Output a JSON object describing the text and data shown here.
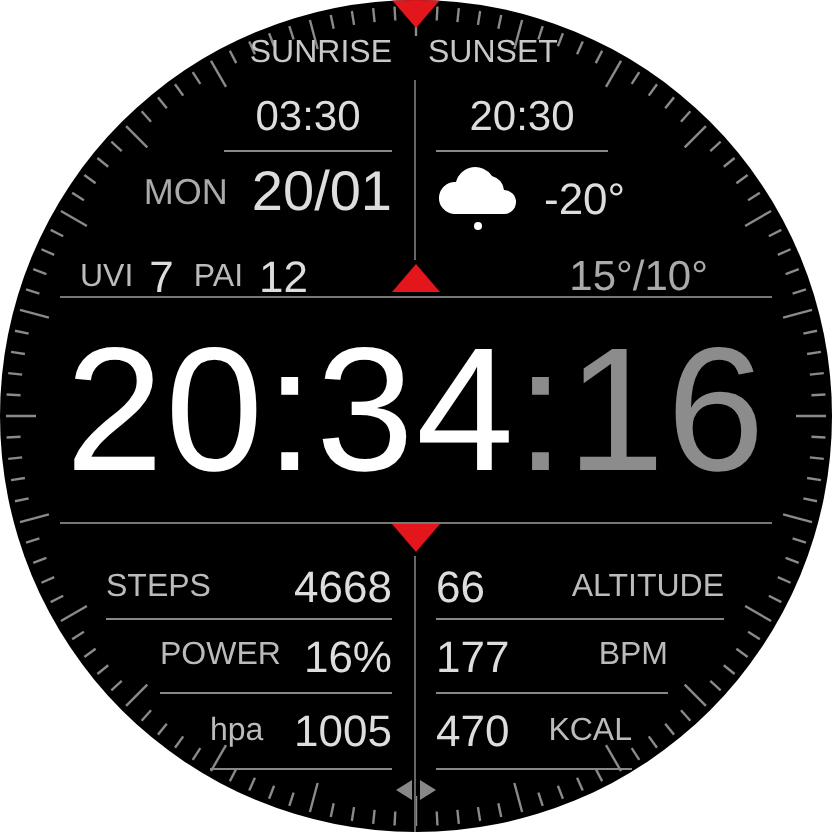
{
  "sun": {
    "sunrise_label": "SUNRISE",
    "sunset_label": "SUNSET",
    "sunrise": "03:30",
    "sunset": "20:30"
  },
  "date": {
    "day": "MON",
    "date": "20/01"
  },
  "weather": {
    "temperature": "-20°",
    "range": "15°/10°"
  },
  "indices": [
    {
      "label": "UVI",
      "value": "7"
    },
    {
      "label": "PAI",
      "value": "12"
    }
  ],
  "time": {
    "hours": "20",
    "separator": ":",
    "minutes": "34",
    "seconds_separator": ":",
    "seconds": "16"
  },
  "stats_left": [
    {
      "label": "STEPS",
      "value": "4668"
    },
    {
      "label": "POWER",
      "value": "16%"
    },
    {
      "label": "hpa",
      "value": "1005"
    }
  ],
  "stats_right": [
    {
      "value": "66",
      "label": "ALTITUDE"
    },
    {
      "value": "177",
      "label": "BPM"
    },
    {
      "value": "470",
      "label": "KCAL"
    }
  ]
}
